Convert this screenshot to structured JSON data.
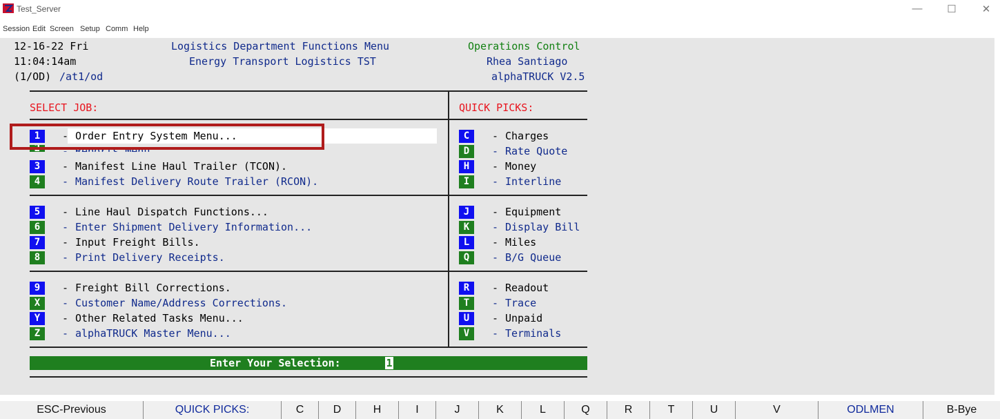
{
  "window": {
    "title": "Test_Server",
    "app_icon": "terminal-app-icon",
    "controls": [
      "—",
      "☐",
      "✕"
    ]
  },
  "menubar": [
    "Session",
    "Edit",
    "Screen",
    "Setup",
    "Comm",
    "Help"
  ],
  "header": {
    "date": "12-16-22 Fri",
    "time": "11:04:14am",
    "session_code": "(1/OD)",
    "path": "/at1/od",
    "menu_title": "Logistics Department Functions Menu",
    "company": "Energy Transport Logistics TST",
    "department": "Operations Control",
    "user": "Rhea Santiago",
    "version": "alphaTRUCK V2.5"
  },
  "select_job": {
    "heading": "SELECT JOB:",
    "items": [
      {
        "key": "1",
        "label": "Order Entry System Menu...",
        "color": "navy"
      },
      {
        "key": "2",
        "label": "Reports Menu...",
        "color": "navy"
      },
      {
        "key": "3",
        "label": "Manifest Line Haul Trailer (TCON).",
        "color": "black"
      },
      {
        "key": "4",
        "label": "Manifest Delivery Route Trailer (RCON).",
        "color": "navy"
      },
      {
        "key": "5",
        "label": "Line Haul Dispatch Functions...",
        "color": "black"
      },
      {
        "key": "6",
        "label": "Enter Shipment Delivery Information...",
        "color": "navy"
      },
      {
        "key": "7",
        "label": "Input Freight Bills.",
        "color": "black"
      },
      {
        "key": "8",
        "label": "Print Delivery Receipts.",
        "color": "navy"
      },
      {
        "key": "9",
        "label": "Freight Bill Corrections.",
        "color": "black"
      },
      {
        "key": "X",
        "label": "Customer Name/Address Corrections.",
        "color": "navy"
      },
      {
        "key": "Y",
        "label": "Other Related Tasks Menu...",
        "color": "black"
      },
      {
        "key": "Z",
        "label": "alphaTRUCK Master Menu...",
        "color": "navy"
      }
    ]
  },
  "quick_picks": {
    "heading": "QUICK PICKS:",
    "items": [
      {
        "key": "C",
        "label": "Charges"
      },
      {
        "key": "D",
        "label": "Rate Quote"
      },
      {
        "key": "H",
        "label": "Money"
      },
      {
        "key": "I",
        "label": "Interline"
      },
      {
        "key": "J",
        "label": "Equipment"
      },
      {
        "key": "K",
        "label": "Display Bill"
      },
      {
        "key": "L",
        "label": "Miles"
      },
      {
        "key": "Q",
        "label": "B/G Queue"
      },
      {
        "key": "R",
        "label": "Readout"
      },
      {
        "key": "T",
        "label": "Trace"
      },
      {
        "key": "U",
        "label": "Unpaid"
      },
      {
        "key": "V",
        "label": "Terminals"
      }
    ]
  },
  "prompt": {
    "label": "Enter Your Selection:",
    "value": "1"
  },
  "separator": "-",
  "function_keys": [
    "ESC-Previous",
    "QUICK PICKS:",
    "C",
    "D",
    "H",
    "I",
    "J",
    "K",
    "L",
    "Q",
    "R",
    "T",
    "U",
    "V",
    "ODLMEN",
    "B-Bye"
  ],
  "colors": {
    "key_blue": "#1010f0",
    "key_green": "#1f7f1f",
    "text_navy": "#102a8c",
    "heading_red": "#e8141e",
    "header_green": "#128012",
    "highlight_red": "#b01c1c"
  }
}
